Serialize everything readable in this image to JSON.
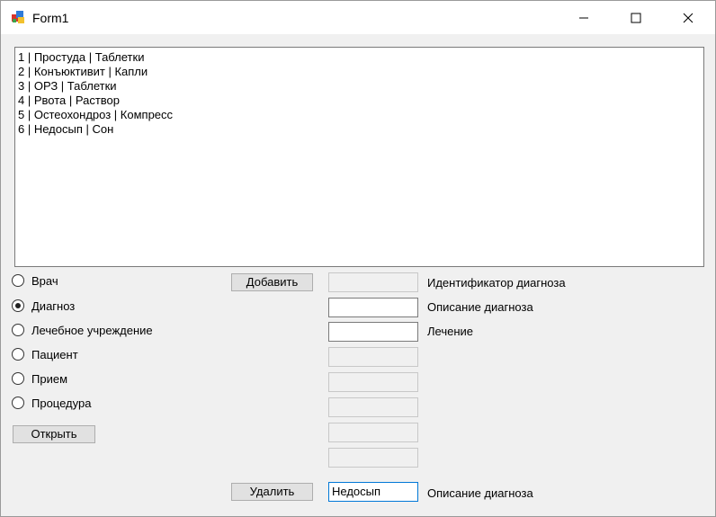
{
  "window": {
    "title": "Form1",
    "icon": "app-form-icon",
    "controls": [
      "minimize-icon",
      "maximize-icon",
      "close-icon"
    ]
  },
  "list": {
    "items": [
      "1 | Простуда | Таблетки",
      "2 | Конъюктивит | Капли",
      "3 | ОРЗ | Таблетки",
      "4 | Рвота | Раствор",
      "5 | Остеохондроз | Компресс",
      "6 | Недосып | Сон"
    ]
  },
  "radios": [
    {
      "label": "Врач",
      "checked": false
    },
    {
      "label": "Диагноз",
      "checked": true
    },
    {
      "label": "Лечебное учреждение",
      "checked": false
    },
    {
      "label": "Пациент",
      "checked": false
    },
    {
      "label": "Прием",
      "checked": false
    },
    {
      "label": "Процедура",
      "checked": false
    }
  ],
  "buttons": {
    "open": "Открыть",
    "add": "Добавить",
    "delete": "Удалить"
  },
  "fields": {
    "id_label": "Идентификатор диагноза",
    "desc_label": "Описание диагноза",
    "treatment_label": "Лечение",
    "delete_label": "Описание диагноза",
    "delete_value": "Недосып"
  }
}
